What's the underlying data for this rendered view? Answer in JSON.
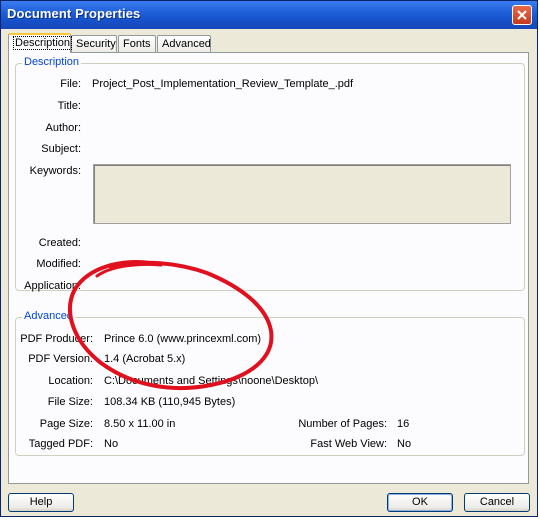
{
  "window": {
    "title": "Document Properties"
  },
  "tabs": [
    {
      "label": "Description"
    },
    {
      "label": "Security"
    },
    {
      "label": "Fonts"
    },
    {
      "label": "Advanced"
    }
  ],
  "description": {
    "group_title": "Description",
    "file_label": "File:",
    "file_value": "Project_Post_Implementation_Review_Template_.pdf",
    "title_label": "Title:",
    "author_label": "Author:",
    "subject_label": "Subject:",
    "keywords_label": "Keywords:",
    "keywords_value": "",
    "created_label": "Created:",
    "modified_label": "Modified:",
    "application_label": "Application:"
  },
  "advanced": {
    "group_title": "Advanced",
    "producer_label": "PDF Producer:",
    "producer_value": "Prince 6.0 (www.princexml.com)",
    "version_label": "PDF Version:",
    "version_value": "1.4 (Acrobat 5.x)",
    "location_label": "Location:",
    "location_value": "C:\\Documents and Settings\\noone\\Desktop\\",
    "filesize_label": "File Size:",
    "filesize_value": "108.34 KB (110,945 Bytes)",
    "pagesize_label": "Page Size:",
    "pagesize_value": "8.50 x 11.00 in",
    "numpages_label": "Number of Pages:",
    "numpages_value": "16",
    "tagged_label": "Tagged PDF:",
    "tagged_value": "No",
    "fastweb_label": "Fast Web View:",
    "fastweb_value": "No"
  },
  "buttons": {
    "help": "Help",
    "ok": "OK",
    "cancel": "Cancel"
  },
  "colors": {
    "scribble": "#e0101e",
    "group_title": "#0046d5",
    "titlebar": "#1f5fd8"
  }
}
